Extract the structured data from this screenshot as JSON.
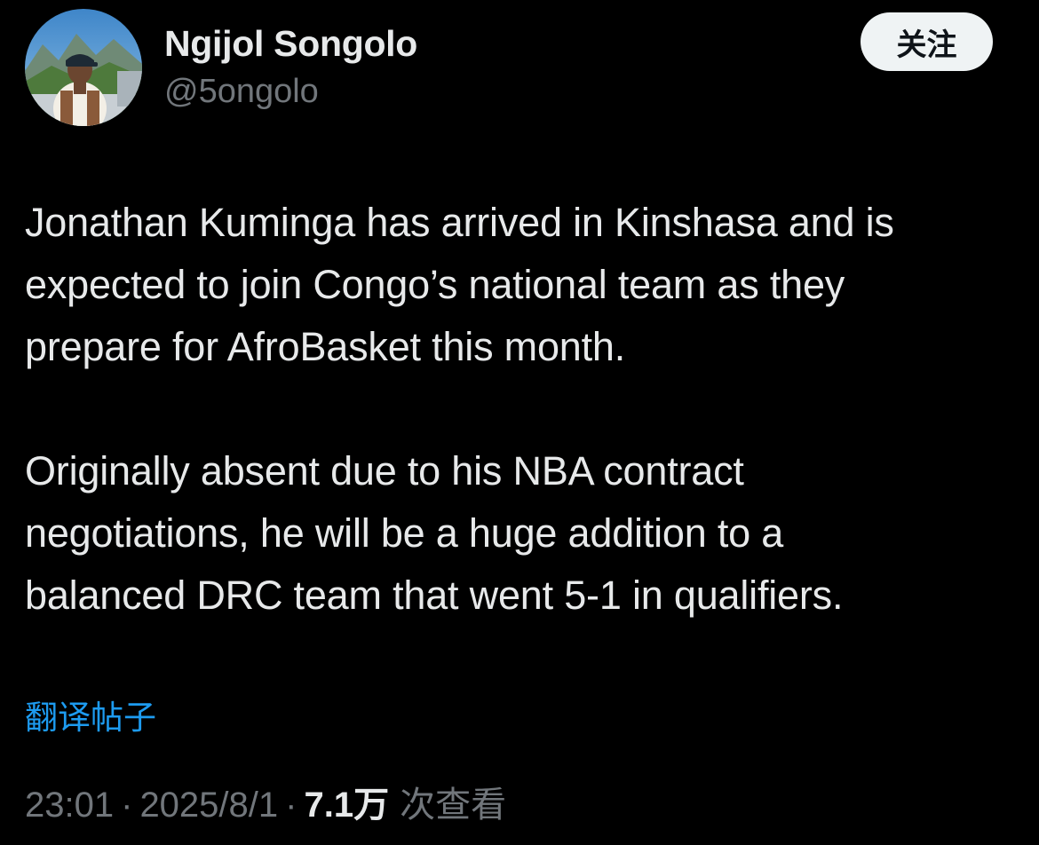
{
  "author": {
    "display_name": "Ngijol Songolo",
    "handle": "@5ongolo",
    "avatar": "profile-photo"
  },
  "follow_button": {
    "label": "关注"
  },
  "tweet": {
    "paragraphs": [
      "Jonathan Kuminga has arrived in Kinshasa and is\nexpected to join Congo’s national team as they\nprepare for AfroBasket this month.",
      "Originally absent due to his NBA contract\nnegotiations, he will be a huge addition to a\nbalanced DRC team that went 5-1 in qualifiers."
    ],
    "translate_label": "翻译帖子"
  },
  "meta": {
    "time": "23:01",
    "separator": "·",
    "date": "2025/8/1",
    "views_count": "7.1万",
    "views_label": "次查看"
  },
  "colors": {
    "background": "#000000",
    "text_primary": "#e7e9ea",
    "text_secondary": "#71767b",
    "link": "#1d9bf0",
    "button_bg": "#eff3f4"
  }
}
